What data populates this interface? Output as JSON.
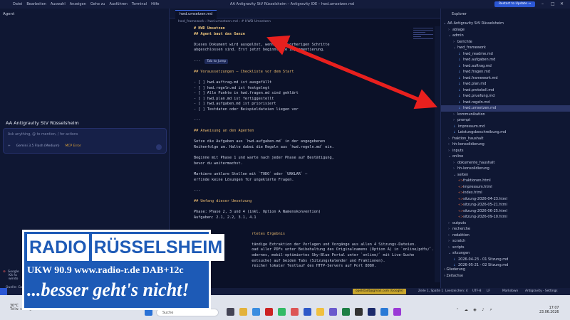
{
  "titlebar": {
    "menu": [
      "Datei",
      "Bearbeiten",
      "Auswahl",
      "Anzeigen",
      "Gehe zu",
      "Ausführen",
      "Terminal",
      "Hilfe"
    ],
    "title": "AA Antigravity StV Rüsselsheim – Antigravity IDE – hwd.umsetzen.md",
    "update_button": "Restart to Update →"
  },
  "agent": {
    "header": "Agent",
    "workspace": "AA Antigravity StV Rüsselsheim",
    "input_placeholder": "Ask anything, @ to mention, / for actions",
    "model": "Gemini 3.5 Flash (Medium)",
    "mcp_error": "MCP Error",
    "notification": "Google",
    "notification_line2": "Kit fu",
    "notification_line3": "windo",
    "quelle": "Quelle: Go"
  },
  "editor": {
    "tab": "hwd.umsetzen.md",
    "breadcrumb": [
      "hwd_framework",
      "hwd.umsetzen.md",
      "# HWD Umsetzen"
    ],
    "tab_to_jump": "Tab to Jump",
    "lines": [
      {
        "cls": "h1",
        "text": "# HWD Umsetzen"
      },
      {
        "cls": "h1",
        "text": "## Agent baut das Ganze"
      },
      {
        "cls": "",
        "text": ""
      },
      {
        "cls": "",
        "text": "Dieses Dokument wird ausgelöst, wenn alle vorherigen Schritte"
      },
      {
        "cls": "",
        "text": "abgeschlossen sind. Erst jetzt beginnt die Implementierung."
      },
      {
        "cls": "",
        "text": ""
      },
      {
        "cls": "jump",
        "text": "---"
      },
      {
        "cls": "",
        "text": ""
      },
      {
        "cls": "acc",
        "text": "## Voraussetzungen – Checkliste vor dem Start"
      },
      {
        "cls": "",
        "text": ""
      },
      {
        "cls": "",
        "text": "- [ ] hwd.auftrag.md ist ausgefüllt"
      },
      {
        "cls": "",
        "text": "- [ ] hwd.regeln.md ist festgelegt"
      },
      {
        "cls": "",
        "text": "- [ ] Alle Punkte in hwd.fragen.md sind geklärt"
      },
      {
        "cls": "",
        "text": "- [ ] hwd.plan.md ist fertiggestellt"
      },
      {
        "cls": "",
        "text": "- [ ] hwd.aufgaben.md ist priorisiert"
      },
      {
        "cls": "",
        "text": "- [ ] Testdaten oder Beispieldateien liegen vor"
      },
      {
        "cls": "",
        "text": ""
      },
      {
        "cls": "",
        "text": "---"
      },
      {
        "cls": "",
        "text": ""
      },
      {
        "cls": "acc",
        "text": "## Anweisung an den Agenten"
      },
      {
        "cls": "",
        "text": ""
      },
      {
        "cls": "",
        "text": "Setze die Aufgaben aus `hwd.aufgaben.md` in der angegebenen"
      },
      {
        "cls": "",
        "text": "Reihenfolge um. Halte dabei die Regeln aus `hwd.regeln.md` ein."
      },
      {
        "cls": "",
        "text": ""
      },
      {
        "cls": "",
        "text": "Beginne mit Phase 1 und warte nach jeder Phase auf Bestätigung,"
      },
      {
        "cls": "",
        "text": "bevor du weitermachst."
      },
      {
        "cls": "",
        "text": ""
      },
      {
        "cls": "",
        "text": "Markiere unklare Stellen mit `TODO` oder `UNKLAR` –"
      },
      {
        "cls": "",
        "text": "erfinde keine Lösungen für ungeklärte Fragen."
      },
      {
        "cls": "",
        "text": ""
      },
      {
        "cls": "",
        "text": "---"
      },
      {
        "cls": "",
        "text": ""
      },
      {
        "cls": "acc",
        "text": "## Umfang dieser Umsetzung"
      },
      {
        "cls": "",
        "text": ""
      },
      {
        "cls": "",
        "text": "Phase: Phase 2, 3 und 4 (inkl. Option A Namenskonvention)"
      },
      {
        "cls": "",
        "text": "Aufgaben: 2.1, 2.2, 3.1, 4.1"
      },
      {
        "cls": "",
        "text": ""
      },
      {
        "cls": "",
        "text": ""
      },
      {
        "cls": "acc",
        "text": "                          rtetes Ergebnis"
      },
      {
        "cls": "",
        "text": ""
      },
      {
        "cls": "",
        "text": "                          tändige Extraktion der Vorlagen und Vorgänge aus allen 4 Sitzungs-Dateien."
      },
      {
        "cls": "",
        "text": "                          oad aller PDFs unter Beibehaltung des Originalnamens (Option A) in `online/pdfs/`."
      },
      {
        "cls": "",
        "text": "                          odernes, mobil-optimiertes Sky-Blue Portal unter `online/` mit Live-Suche"
      },
      {
        "cls": "",
        "text": "                          extsuche) auf beiden Tabs (Sitzungskalender und Fraktionen)."
      },
      {
        "cls": "",
        "text": "                          reicher lokaler Testlauf des HTTP-Servers auf Port 8080."
      }
    ]
  },
  "explorer": {
    "header": "Explorer",
    "root": "AA Antigravity StV Rüsselsheim",
    "tree": [
      {
        "depth": 1,
        "type": "folder",
        "open": false,
        "name": "ablage"
      },
      {
        "depth": 1,
        "type": "folder",
        "open": true,
        "name": "admin"
      },
      {
        "depth": 2,
        "type": "folder",
        "open": false,
        "name": "berichte"
      },
      {
        "depth": 2,
        "type": "folder",
        "open": true,
        "name": "hwd_framework"
      },
      {
        "depth": 3,
        "type": "file",
        "name": "hwd_readme.md"
      },
      {
        "depth": 3,
        "type": "file",
        "name": "hwd.aufgaben.md"
      },
      {
        "depth": 3,
        "type": "file",
        "name": "hwd.auftrag.md"
      },
      {
        "depth": 3,
        "type": "file",
        "name": "hwd.fragen.md"
      },
      {
        "depth": 3,
        "type": "file",
        "name": "hwd.framework.md"
      },
      {
        "depth": 3,
        "type": "file",
        "name": "hwd.plan.md"
      },
      {
        "depth": 3,
        "type": "file",
        "name": "hwd.protokoll.md"
      },
      {
        "depth": 3,
        "type": "file",
        "name": "hwd.pruefung.md"
      },
      {
        "depth": 3,
        "type": "file",
        "name": "hwd.regeln.md"
      },
      {
        "depth": 3,
        "type": "file",
        "name": "hwd.umsetzen.md",
        "selected": true
      },
      {
        "depth": 2,
        "type": "folder",
        "open": false,
        "name": "kommunikation"
      },
      {
        "depth": 2,
        "type": "folder",
        "open": false,
        "name": "prompt"
      },
      {
        "depth": 2,
        "type": "file",
        "name": "impressum.md"
      },
      {
        "depth": 2,
        "type": "file",
        "name": "Leistungsbeschreibung.md"
      },
      {
        "depth": 1,
        "type": "folder",
        "open": false,
        "name": "fraktion_haushalt"
      },
      {
        "depth": 1,
        "type": "folder",
        "open": false,
        "name": "hh-konsolidierung"
      },
      {
        "depth": 1,
        "type": "folder",
        "open": false,
        "name": "inputs"
      },
      {
        "depth": 1,
        "type": "folder",
        "open": true,
        "name": "online"
      },
      {
        "depth": 2,
        "type": "folder",
        "open": false,
        "name": "dokumente_haushalt"
      },
      {
        "depth": 2,
        "type": "folder",
        "open": false,
        "name": "hh-konsolidierung"
      },
      {
        "depth": 2,
        "type": "folder",
        "open": true,
        "name": "seiten"
      },
      {
        "depth": 3,
        "type": "html",
        "name": "fraktionen.html"
      },
      {
        "depth": 3,
        "type": "html",
        "name": "impressum.html"
      },
      {
        "depth": 3,
        "type": "html",
        "name": "index.html"
      },
      {
        "depth": 3,
        "type": "html",
        "name": "sitzung-2026-04-23.html"
      },
      {
        "depth": 3,
        "type": "html",
        "name": "sitzung-2026-05-21.html"
      },
      {
        "depth": 3,
        "type": "html",
        "name": "sitzung-2026-06-25.html"
      },
      {
        "depth": 3,
        "type": "html",
        "name": "sitzung-2026-09-10.html"
      },
      {
        "depth": 1,
        "type": "folder",
        "open": false,
        "name": "outputs"
      },
      {
        "depth": 1,
        "type": "folder",
        "open": false,
        "name": "recherche"
      },
      {
        "depth": 1,
        "type": "folder",
        "open": false,
        "name": "redaktion"
      },
      {
        "depth": 1,
        "type": "folder",
        "open": false,
        "name": "scratch"
      },
      {
        "depth": 1,
        "type": "folder",
        "open": false,
        "name": "scripts"
      },
      {
        "depth": 1,
        "type": "folder",
        "open": true,
        "name": "sitzungen"
      },
      {
        "depth": 2,
        "type": "file",
        "name": "2026-04-23 - 01 Sitzung.md"
      },
      {
        "depth": 2,
        "type": "file",
        "name": "2026-05-21 - 02 Sitzung.md"
      }
    ],
    "outline": "Gliederung",
    "timeline": "Zeitachse"
  },
  "statusbar": {
    "account": "opelstadt@gmail.com (Google)",
    "position": "Zeile 1, Spalte 1",
    "spaces": "Leerzeichen: 4",
    "encoding": "UTF-8",
    "eol": "LF",
    "language": "Markdown",
    "settings": "Antigravity - Settings"
  },
  "taskbar": {
    "temp": "30°C",
    "weather": "Teilw. sonnig",
    "search_placeholder": "Suche",
    "time": "17:07",
    "date": "23.06.2026"
  },
  "logo": {
    "word1": "RADIO",
    "word2": "RÜSSELSHEIM",
    "freq": "UKW 90.9    www.radio-r.de    DAB+12c",
    "slogan": "...besser geht's nicht!"
  },
  "colors": {
    "accent": "#2b57d4",
    "arrow": "#e8201e",
    "logo_blue": "#1d5ab6"
  }
}
